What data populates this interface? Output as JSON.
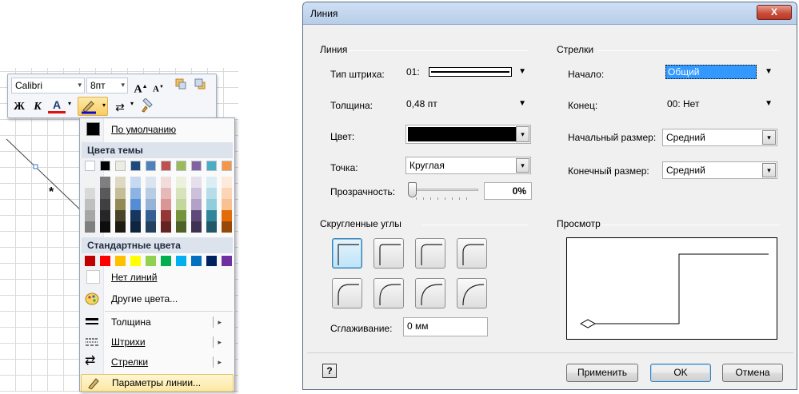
{
  "toolbar": {
    "font_name": "Calibri",
    "font_size": "8пт",
    "bold_label": "Ж",
    "italic_label": "К",
    "font_color_label": "A",
    "grow_font_icon": "increase-font-icon",
    "shrink_font_icon": "decrease-font-icon"
  },
  "canvas": {
    "asterisk": "*"
  },
  "color_menu": {
    "default_label": "По умолчанию",
    "theme_colors_header": "Цвета темы",
    "theme_top_row": [
      "#ffffff",
      "#000000",
      "#eeece1",
      "#1f497d",
      "#4f81bd",
      "#c0504d",
      "#9bbb59",
      "#8064a2",
      "#4bacc6",
      "#f79646"
    ],
    "theme_columns": [
      [
        "#f2f2f2",
        "#d9d9d9",
        "#bfbfbf",
        "#a6a6a6",
        "#7f7f7f"
      ],
      [
        "#7f7f7f",
        "#595959",
        "#404040",
        "#262626",
        "#0d0d0d"
      ],
      [
        "#ddd9c3",
        "#c4bd97",
        "#938953",
        "#494429",
        "#1d1b10"
      ],
      [
        "#c6d9f0",
        "#8db3e2",
        "#548dd4",
        "#17365d",
        "#0f243e"
      ],
      [
        "#dbe5f1",
        "#b8cce4",
        "#95b3d7",
        "#366092",
        "#244061"
      ],
      [
        "#f2dcdb",
        "#e5b9b7",
        "#d99694",
        "#953734",
        "#632423"
      ],
      [
        "#ebf1dd",
        "#d7e3bc",
        "#c3d69b",
        "#76923c",
        "#4f6128"
      ],
      [
        "#e5e0ec",
        "#ccc1d9",
        "#b2a2c7",
        "#5f497a",
        "#3f3151"
      ],
      [
        "#dbeef3",
        "#b7dde8",
        "#92cddc",
        "#31859b",
        "#205867"
      ],
      [
        "#fdeada",
        "#fbd5b5",
        "#fac08f",
        "#e36c09",
        "#974806"
      ]
    ],
    "standard_colors_header": "Стандартные цвета",
    "standard_colors": [
      "#c00000",
      "#ff0000",
      "#ffc000",
      "#ffff00",
      "#92d050",
      "#00b050",
      "#00b0f0",
      "#0070c0",
      "#002060",
      "#7030a0"
    ],
    "no_line_label": "Нет линий",
    "more_colors_label": "Другие цвета...",
    "weight_label": "Толщина",
    "dashes_label": "Штрихи",
    "arrows_label": "Стрелки",
    "line_options_label": "Параметры линии..."
  },
  "dialog": {
    "title": "Линия",
    "close_label": "X",
    "line_group": "Линия",
    "dash_type_label": "Тип штриха:",
    "dash_type_value": "01:",
    "weight_label": "Толщина:",
    "weight_value": "0,48 пт",
    "color_label": "Цвет:",
    "color_value": "#000000",
    "cap_label": "Точка:",
    "cap_value": "Круглая",
    "transparency_label": "Прозрачность:",
    "transparency_value": "0%",
    "transparency_level": 0,
    "arrows_group": "Стрелки",
    "begin_label": "Начало:",
    "begin_value": "Общий",
    "end_label": "Конец:",
    "end_value": "00: Нет",
    "begin_size_label": "Начальный размер:",
    "begin_size_value": "Средний",
    "end_size_label": "Конечный размер:",
    "end_size_value": "Средний",
    "rounded_group": "Скругленные углы",
    "smoothing_label": "Сглаживание:",
    "smoothing_value": "0 мм",
    "preview_group": "Просмотр",
    "help_label": "?",
    "apply_label": "Применить",
    "ok_label": "OK",
    "cancel_label": "Отмена"
  }
}
